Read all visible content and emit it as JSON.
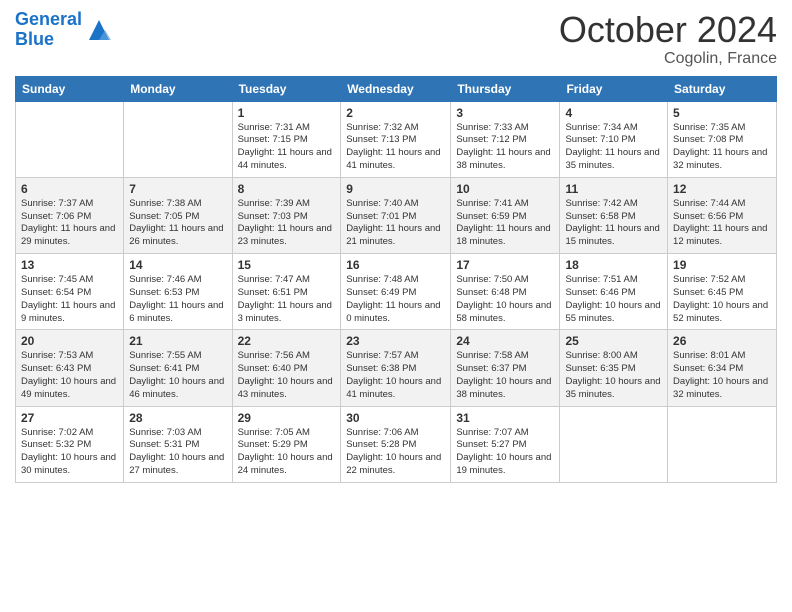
{
  "header": {
    "logo_line1": "General",
    "logo_line2": "Blue",
    "month_title": "October 2024",
    "subtitle": "Cogolin, France"
  },
  "weekdays": [
    "Sunday",
    "Monday",
    "Tuesday",
    "Wednesday",
    "Thursday",
    "Friday",
    "Saturday"
  ],
  "weeks": [
    [
      {
        "day": "",
        "sunrise": "",
        "sunset": "",
        "daylight": ""
      },
      {
        "day": "",
        "sunrise": "",
        "sunset": "",
        "daylight": ""
      },
      {
        "day": "1",
        "sunrise": "Sunrise: 7:31 AM",
        "sunset": "Sunset: 7:15 PM",
        "daylight": "Daylight: 11 hours and 44 minutes."
      },
      {
        "day": "2",
        "sunrise": "Sunrise: 7:32 AM",
        "sunset": "Sunset: 7:13 PM",
        "daylight": "Daylight: 11 hours and 41 minutes."
      },
      {
        "day": "3",
        "sunrise": "Sunrise: 7:33 AM",
        "sunset": "Sunset: 7:12 PM",
        "daylight": "Daylight: 11 hours and 38 minutes."
      },
      {
        "day": "4",
        "sunrise": "Sunrise: 7:34 AM",
        "sunset": "Sunset: 7:10 PM",
        "daylight": "Daylight: 11 hours and 35 minutes."
      },
      {
        "day": "5",
        "sunrise": "Sunrise: 7:35 AM",
        "sunset": "Sunset: 7:08 PM",
        "daylight": "Daylight: 11 hours and 32 minutes."
      }
    ],
    [
      {
        "day": "6",
        "sunrise": "Sunrise: 7:37 AM",
        "sunset": "Sunset: 7:06 PM",
        "daylight": "Daylight: 11 hours and 29 minutes."
      },
      {
        "day": "7",
        "sunrise": "Sunrise: 7:38 AM",
        "sunset": "Sunset: 7:05 PM",
        "daylight": "Daylight: 11 hours and 26 minutes."
      },
      {
        "day": "8",
        "sunrise": "Sunrise: 7:39 AM",
        "sunset": "Sunset: 7:03 PM",
        "daylight": "Daylight: 11 hours and 23 minutes."
      },
      {
        "day": "9",
        "sunrise": "Sunrise: 7:40 AM",
        "sunset": "Sunset: 7:01 PM",
        "daylight": "Daylight: 11 hours and 21 minutes."
      },
      {
        "day": "10",
        "sunrise": "Sunrise: 7:41 AM",
        "sunset": "Sunset: 6:59 PM",
        "daylight": "Daylight: 11 hours and 18 minutes."
      },
      {
        "day": "11",
        "sunrise": "Sunrise: 7:42 AM",
        "sunset": "Sunset: 6:58 PM",
        "daylight": "Daylight: 11 hours and 15 minutes."
      },
      {
        "day": "12",
        "sunrise": "Sunrise: 7:44 AM",
        "sunset": "Sunset: 6:56 PM",
        "daylight": "Daylight: 11 hours and 12 minutes."
      }
    ],
    [
      {
        "day": "13",
        "sunrise": "Sunrise: 7:45 AM",
        "sunset": "Sunset: 6:54 PM",
        "daylight": "Daylight: 11 hours and 9 minutes."
      },
      {
        "day": "14",
        "sunrise": "Sunrise: 7:46 AM",
        "sunset": "Sunset: 6:53 PM",
        "daylight": "Daylight: 11 hours and 6 minutes."
      },
      {
        "day": "15",
        "sunrise": "Sunrise: 7:47 AM",
        "sunset": "Sunset: 6:51 PM",
        "daylight": "Daylight: 11 hours and 3 minutes."
      },
      {
        "day": "16",
        "sunrise": "Sunrise: 7:48 AM",
        "sunset": "Sunset: 6:49 PM",
        "daylight": "Daylight: 11 hours and 0 minutes."
      },
      {
        "day": "17",
        "sunrise": "Sunrise: 7:50 AM",
        "sunset": "Sunset: 6:48 PM",
        "daylight": "Daylight: 10 hours and 58 minutes."
      },
      {
        "day": "18",
        "sunrise": "Sunrise: 7:51 AM",
        "sunset": "Sunset: 6:46 PM",
        "daylight": "Daylight: 10 hours and 55 minutes."
      },
      {
        "day": "19",
        "sunrise": "Sunrise: 7:52 AM",
        "sunset": "Sunset: 6:45 PM",
        "daylight": "Daylight: 10 hours and 52 minutes."
      }
    ],
    [
      {
        "day": "20",
        "sunrise": "Sunrise: 7:53 AM",
        "sunset": "Sunset: 6:43 PM",
        "daylight": "Daylight: 10 hours and 49 minutes."
      },
      {
        "day": "21",
        "sunrise": "Sunrise: 7:55 AM",
        "sunset": "Sunset: 6:41 PM",
        "daylight": "Daylight: 10 hours and 46 minutes."
      },
      {
        "day": "22",
        "sunrise": "Sunrise: 7:56 AM",
        "sunset": "Sunset: 6:40 PM",
        "daylight": "Daylight: 10 hours and 43 minutes."
      },
      {
        "day": "23",
        "sunrise": "Sunrise: 7:57 AM",
        "sunset": "Sunset: 6:38 PM",
        "daylight": "Daylight: 10 hours and 41 minutes."
      },
      {
        "day": "24",
        "sunrise": "Sunrise: 7:58 AM",
        "sunset": "Sunset: 6:37 PM",
        "daylight": "Daylight: 10 hours and 38 minutes."
      },
      {
        "day": "25",
        "sunrise": "Sunrise: 8:00 AM",
        "sunset": "Sunset: 6:35 PM",
        "daylight": "Daylight: 10 hours and 35 minutes."
      },
      {
        "day": "26",
        "sunrise": "Sunrise: 8:01 AM",
        "sunset": "Sunset: 6:34 PM",
        "daylight": "Daylight: 10 hours and 32 minutes."
      }
    ],
    [
      {
        "day": "27",
        "sunrise": "Sunrise: 7:02 AM",
        "sunset": "Sunset: 5:32 PM",
        "daylight": "Daylight: 10 hours and 30 minutes."
      },
      {
        "day": "28",
        "sunrise": "Sunrise: 7:03 AM",
        "sunset": "Sunset: 5:31 PM",
        "daylight": "Daylight: 10 hours and 27 minutes."
      },
      {
        "day": "29",
        "sunrise": "Sunrise: 7:05 AM",
        "sunset": "Sunset: 5:29 PM",
        "daylight": "Daylight: 10 hours and 24 minutes."
      },
      {
        "day": "30",
        "sunrise": "Sunrise: 7:06 AM",
        "sunset": "Sunset: 5:28 PM",
        "daylight": "Daylight: 10 hours and 22 minutes."
      },
      {
        "day": "31",
        "sunrise": "Sunrise: 7:07 AM",
        "sunset": "Sunset: 5:27 PM",
        "daylight": "Daylight: 10 hours and 19 minutes."
      },
      {
        "day": "",
        "sunrise": "",
        "sunset": "",
        "daylight": ""
      },
      {
        "day": "",
        "sunrise": "",
        "sunset": "",
        "daylight": ""
      }
    ]
  ]
}
